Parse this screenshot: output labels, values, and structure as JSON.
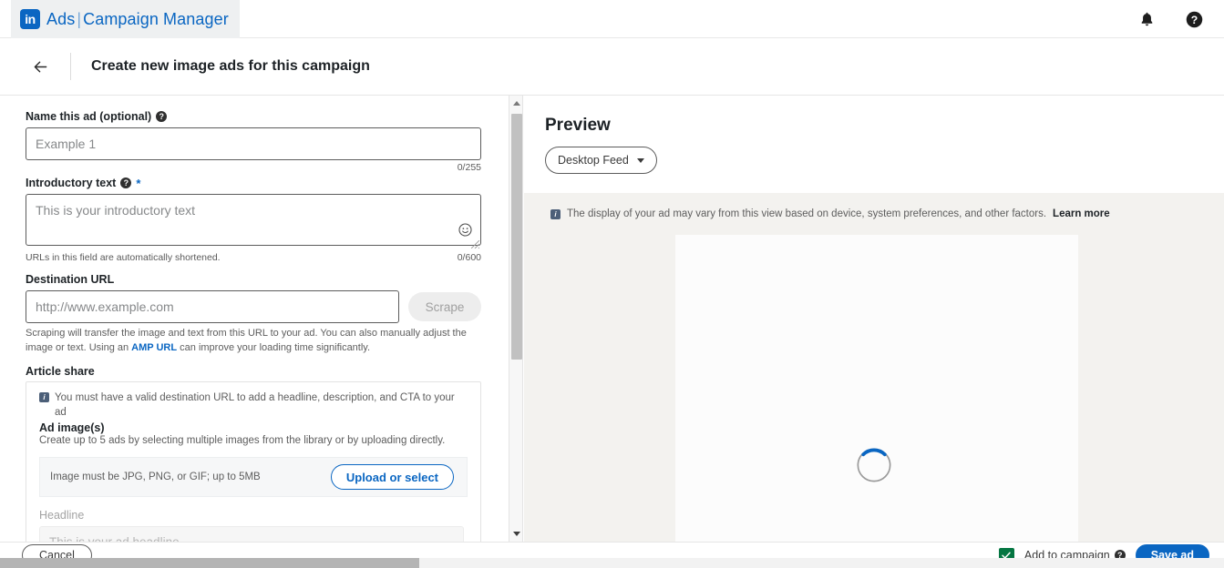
{
  "topbar": {
    "logo_text": "in",
    "brand_ads": "Ads",
    "brand_sep": "|",
    "brand_manager": "Campaign Manager",
    "notifications_icon": "bell-icon",
    "help_icon": "help-circle-icon"
  },
  "subheader": {
    "back_icon": "arrow-left-icon",
    "title": "Create new image ads for this campaign"
  },
  "form": {
    "name_field": {
      "label": "Name this ad (optional)",
      "help_icon": "help-circle-icon",
      "placeholder": "Example 1",
      "value": "",
      "counter": "0/255"
    },
    "intro_field": {
      "label": "Introductory text",
      "help_icon": "help-circle-icon",
      "required_mark": "*",
      "placeholder": "This is your introductory text",
      "value": "",
      "emoji_icon": "emoji-smiley-icon",
      "note": "URLs in this field are automatically shortened.",
      "counter": "0/600"
    },
    "url_field": {
      "label": "Destination URL",
      "placeholder": "http://www.example.com",
      "value": "",
      "scrape_button": "Scrape",
      "helper_pre": "Scraping will transfer the image and text from this URL to your ad. You can also manually adjust the image or text. Using an ",
      "helper_link": "AMP URL",
      "helper_post": " can improve your loading time significantly."
    },
    "article_share": {
      "label": "Article share",
      "notice_icon": "info-icon",
      "notice": "You must have a valid destination URL to add a headline, description, and CTA to your ad",
      "ad_images_heading": "Ad image(s)",
      "ad_images_desc": "Create up to 5 ads by selecting multiple images from the library or by uploading directly.",
      "upload_note": "Image must be JPG, PNG, or GIF; up to 5MB",
      "upload_button": "Upload or select",
      "headline_label": "Headline",
      "headline_placeholder": "This is your ad headline"
    }
  },
  "preview": {
    "title": "Preview",
    "device_select": "Desktop Feed",
    "caret_icon": "chevron-down-icon",
    "notice_icon": "info-icon",
    "notice_text": "The display of your ad may vary from this view based on device, system preferences, and other factors.",
    "notice_link": "Learn more",
    "loading_icon": "loading-spinner"
  },
  "footer": {
    "cancel_label": "Cancel",
    "checkbox_icon": "checkmark-icon",
    "checkbox_label": "Add to campaign",
    "checkbox_help_icon": "help-circle-icon",
    "save_label": "Save ad"
  },
  "colors": {
    "linkedin_blue": "#0a66c2",
    "green_check": "#057642",
    "preview_bg": "#f3f2ef",
    "info_icon": "#4c5f78"
  }
}
